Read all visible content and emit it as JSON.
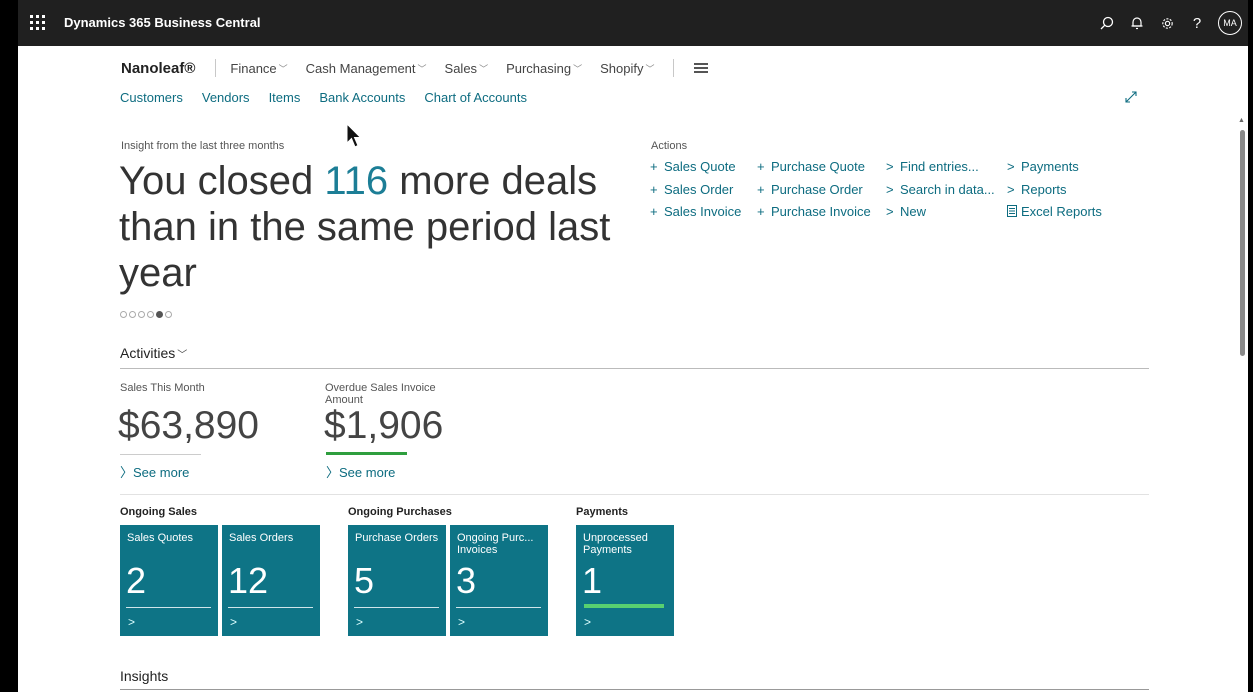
{
  "app": {
    "title": "Dynamics 365 Business Central"
  },
  "topbar": {
    "avatar": "MA"
  },
  "nav": {
    "company": "Nanoleaf®",
    "menus": [
      "Finance",
      "Cash Management",
      "Sales",
      "Purchasing",
      "Shopify"
    ],
    "links": [
      "Customers",
      "Vendors",
      "Items",
      "Bank Accounts",
      "Chart of Accounts"
    ]
  },
  "headline": {
    "label": "Insight from the last three months",
    "part1": "You closed ",
    "number": "116",
    "part2": " more deals than in the same period last year",
    "carousel_total": 6,
    "carousel_active": 5
  },
  "actions": {
    "label": "Actions",
    "col1": [
      "Sales Quote",
      "Sales Order",
      "Sales Invoice"
    ],
    "col2": [
      "Purchase Quote",
      "Purchase Order",
      "Purchase Invoice"
    ],
    "col3": [
      "Find entries...",
      "Search in data...",
      "New"
    ],
    "col4": [
      "Payments",
      "Reports"
    ],
    "excel_reports": "Excel Reports"
  },
  "activities": {
    "title": "Activities",
    "kpi1": {
      "label": "Sales This Month",
      "value": "$63,890",
      "see_more": "See more"
    },
    "kpi2": {
      "label_line1": "Overdue Sales Invoice",
      "label_line2": "Amount",
      "value": "$1,906",
      "see_more": "See more"
    }
  },
  "cue_groups": {
    "ongoing_sales": "Ongoing Sales",
    "ongoing_purchases": "Ongoing Purchases",
    "payments": "Payments"
  },
  "cues": [
    {
      "title": "Sales Quotes",
      "value": "2"
    },
    {
      "title": "Sales Orders",
      "value": "12"
    },
    {
      "title": "Purchase Orders",
      "value": "5"
    },
    {
      "title": "Ongoing Purc... Invoices",
      "value": "3"
    },
    {
      "title": "Unprocessed Payments",
      "value": "1"
    }
  ],
  "insights": {
    "title": "Insights"
  },
  "colors": {
    "topbar": "#202020",
    "accent": "#0d6c80",
    "cue_tile": "#0e7486",
    "kpi_green": "#2e9e3e"
  }
}
